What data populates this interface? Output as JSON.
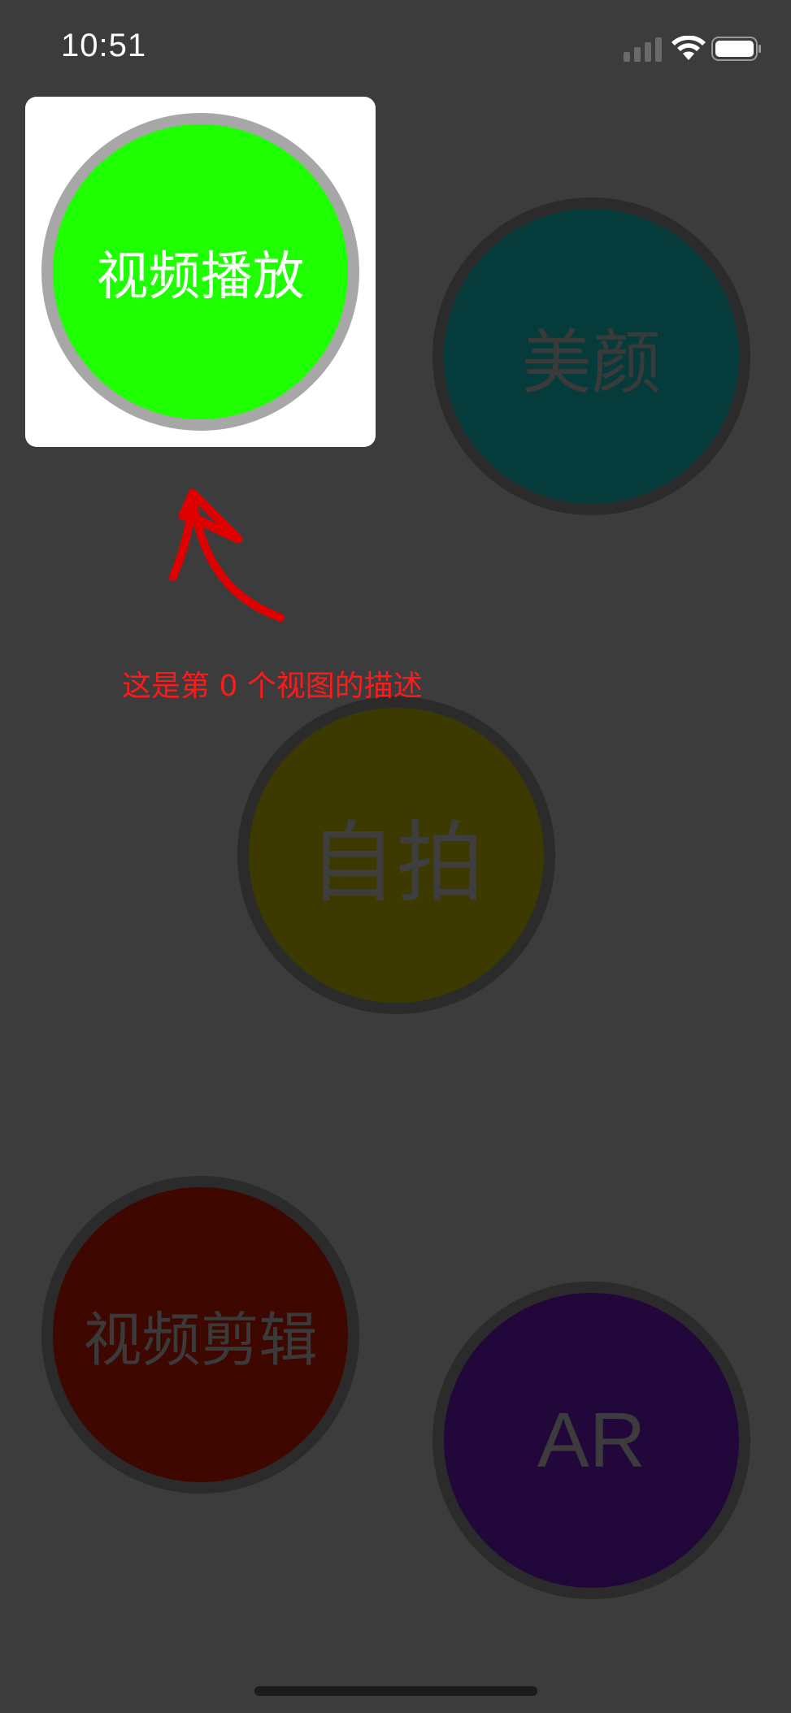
{
  "status_bar": {
    "time": "10:51",
    "icons": [
      "signal-icon",
      "wifi-icon",
      "battery-icon"
    ]
  },
  "buttons": {
    "video_play": {
      "label": "视频播放",
      "color": "#1eff00"
    },
    "beauty": {
      "label": "美颜",
      "color": "#063b3b"
    },
    "selfie": {
      "label": "自拍",
      "color": "#3c3a00"
    },
    "video_edit": {
      "label": "视频剪辑",
      "color": "#3e0800"
    },
    "ar": {
      "label": "AR",
      "color": "#22073a"
    }
  },
  "guide": {
    "description": "这是第 0 个视图的描述",
    "arrow_color": "#ff1a1a"
  },
  "colors": {
    "background": "#3c3c3c",
    "highlight_card": "#ffffff"
  }
}
